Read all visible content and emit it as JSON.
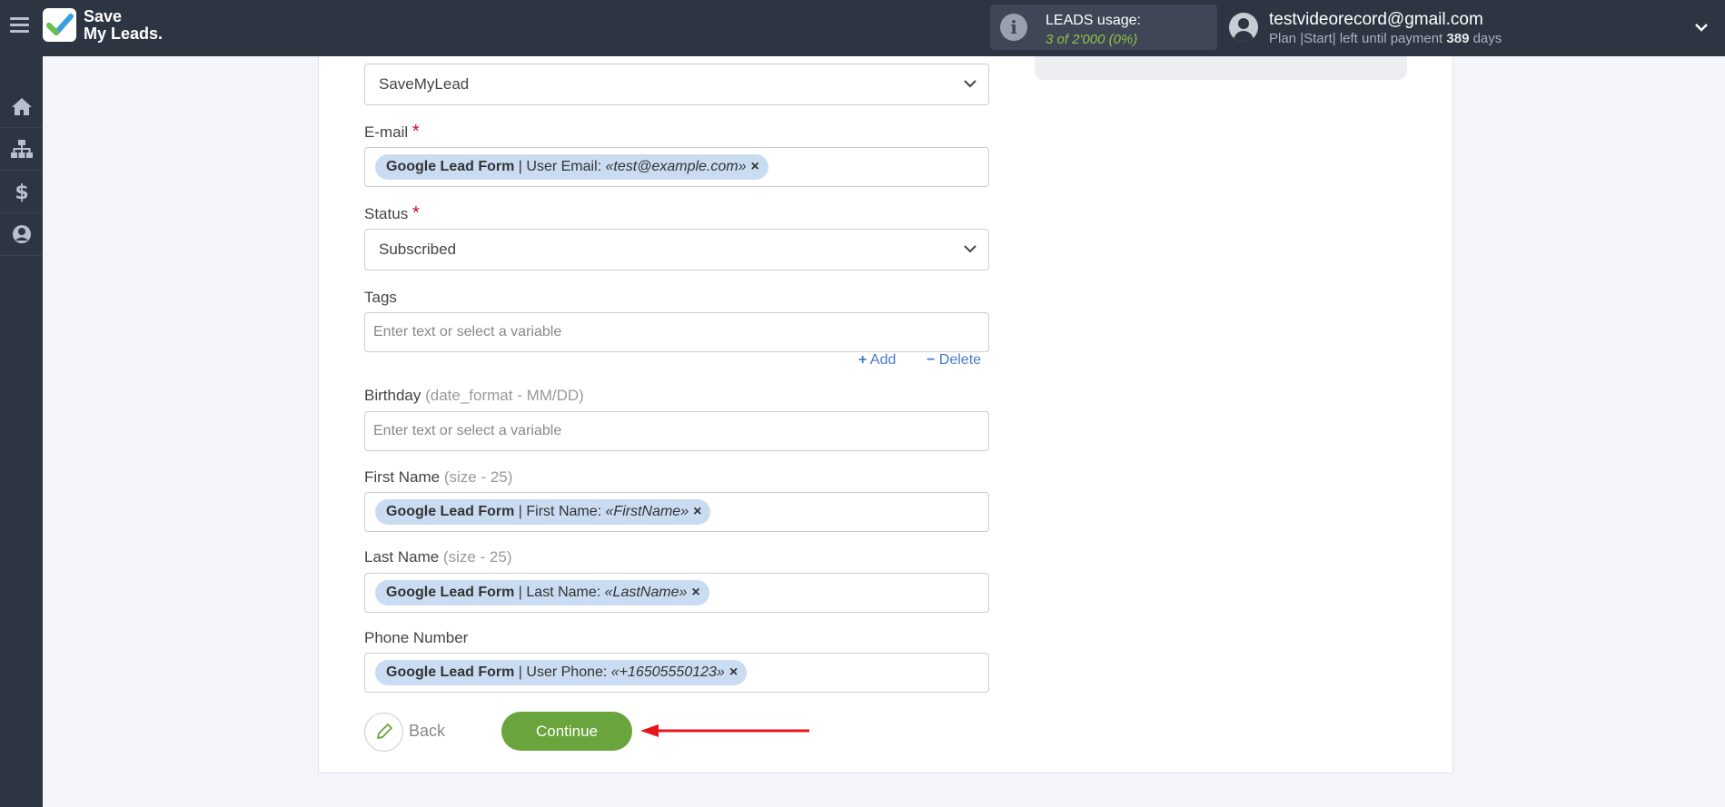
{
  "app": {
    "logo_line1": "Save",
    "logo_line2": "My Leads.",
    "leads_usage_title": "LEADS usage:",
    "leads_usage_value": "3  of 2'000 (0%)",
    "user_email": "testvideorecord@gmail.com",
    "plan_prefix": "Plan |Start| left until payment ",
    "plan_days": "389",
    "plan_suffix": " days"
  },
  "sidebar": {
    "items": [
      "home-icon",
      "sitemap-icon",
      "dollar-icon",
      "user-circle-icon"
    ]
  },
  "form": {
    "first_select_value": "SaveMyLead",
    "email": {
      "label": "E-mail",
      "required": "*",
      "tag_source": "Google Lead Form",
      "tag_field": " | User Email: ",
      "tag_value": "«test@example.com»",
      "tag_remove": "×"
    },
    "status": {
      "label": "Status",
      "required": "*",
      "value": "Subscribed"
    },
    "tags": {
      "label": "Tags",
      "placeholder": "Enter text or select a variable",
      "add_label": "Add",
      "delete_label": "Delete"
    },
    "birthday": {
      "label": "Birthday",
      "hint": " (date_format - MM/DD)",
      "placeholder": "Enter text or select a variable"
    },
    "first_name": {
      "label": "First Name",
      "hint": " (size - 25)",
      "tag_source": "Google Lead Form",
      "tag_field": " | First Name: ",
      "tag_value": "«FirstName»",
      "tag_remove": "×"
    },
    "last_name": {
      "label": "Last Name",
      "hint": " (size - 25)",
      "tag_source": "Google Lead Form",
      "tag_field": " | Last Name: ",
      "tag_value": "«LastName»",
      "tag_remove": "×"
    },
    "phone": {
      "label": "Phone Number",
      "tag_source": "Google Lead Form",
      "tag_field": " | User Phone: ",
      "tag_value": "«+16505550123»",
      "tag_remove": "×"
    },
    "back_label": "Back",
    "continue_label": "Continue"
  },
  "colors": {
    "topbar": "#2e3542",
    "accent_green": "#6aa43c",
    "tag_bg": "#c9dcf2",
    "arrow_red": "#e8141b"
  }
}
